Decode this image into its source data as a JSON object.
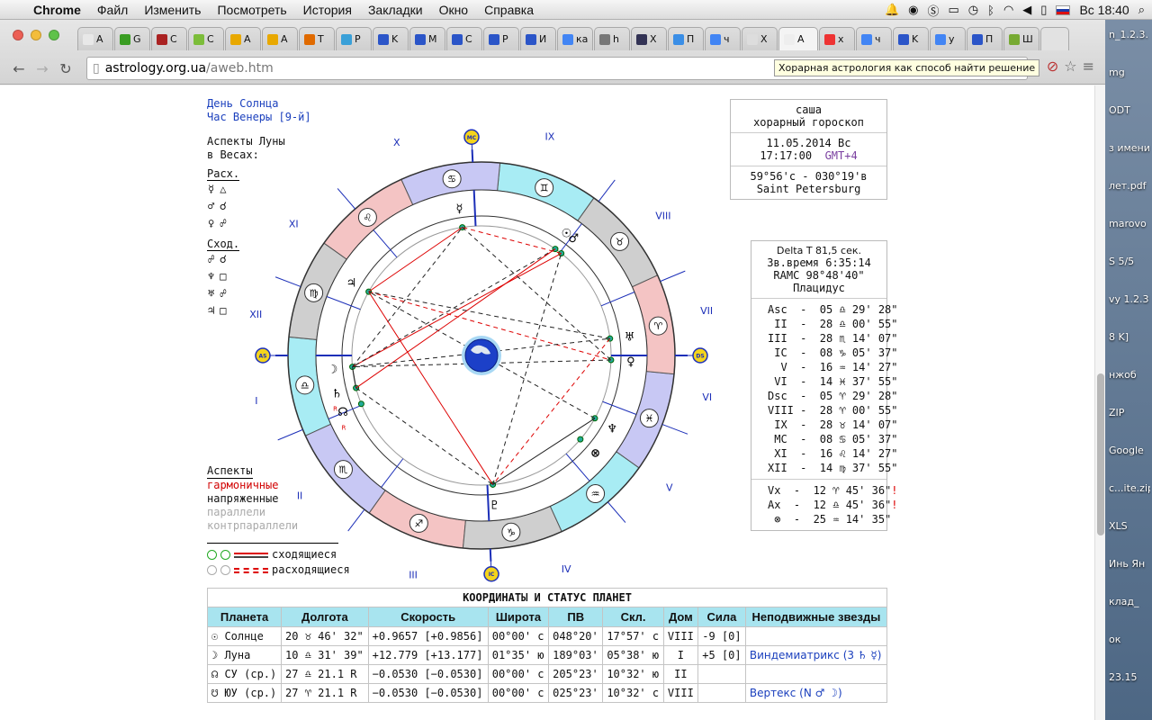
{
  "menubar": {
    "apple": "",
    "app": "Chrome",
    "items": [
      "Файл",
      "Изменить",
      "Посмотреть",
      "История",
      "Закладки",
      "Окно",
      "Справка"
    ],
    "clock": "Вс 18:40"
  },
  "browser": {
    "tabs": [
      {
        "label": "A",
        "color": "#e8e8e8"
      },
      {
        "label": "G",
        "color": "#3a9d23"
      },
      {
        "label": "C",
        "color": "#a22"
      },
      {
        "label": "C",
        "color": "#7cbd3a"
      },
      {
        "label": "A",
        "color": "#e8a800"
      },
      {
        "label": "A",
        "color": "#e8a800"
      },
      {
        "label": "T",
        "color": "#e06a00"
      },
      {
        "label": "P",
        "color": "#3aa0d8"
      },
      {
        "label": "K",
        "color": "#2b55c8"
      },
      {
        "label": "M",
        "color": "#2b55c8"
      },
      {
        "label": "C",
        "color": "#2b55c8"
      },
      {
        "label": "P",
        "color": "#2b55c8"
      },
      {
        "label": "И",
        "color": "#2b55c8"
      },
      {
        "label": "ка",
        "color": "#4285f4"
      },
      {
        "label": "h",
        "color": "#777"
      },
      {
        "label": "X",
        "color": "#335"
      },
      {
        "label": "П",
        "color": "#3a8ee6"
      },
      {
        "label": "ч",
        "color": "#4285f4"
      },
      {
        "label": "X",
        "color": "#ddd"
      },
      {
        "label": "A",
        "color": "#eee"
      },
      {
        "label": "x",
        "color": "#e33"
      },
      {
        "label": "ч",
        "color": "#4285f4"
      },
      {
        "label": "K",
        "color": "#2b55c8"
      },
      {
        "label": "y",
        "color": "#4285f4"
      },
      {
        "label": "П",
        "color": "#2b55c8"
      },
      {
        "label": "Ш",
        "color": "#7a3"
      }
    ],
    "url_domain": "astrology.org.ua",
    "url_path": "/aweb.htm",
    "tooltip": "Хорарная астрология как способ найти решение"
  },
  "desktop": {
    "icons": [
      "n_1.2.3.",
      "mg",
      "ODT",
      "з имени",
      "лет.pdf",
      "marovo",
      "S 5/5",
      "vy 1.2.3",
      "8 K]",
      "нжоб",
      "ZIP",
      "Google",
      "c...ite.zip",
      "XLS",
      "Инь Ян",
      "клад_",
      "ок",
      "23.15"
    ]
  },
  "chart_info": {
    "day": "День Солнца",
    "hour": "Час Венеры [9-й]",
    "moon_aspects_title": "Аспекты Луны",
    "moon_aspects_sign": "в Весах:",
    "separating_label": "Расх.",
    "separating": [
      {
        "planet": "☿",
        "aspect": "△"
      },
      {
        "planet": "♂",
        "aspect": "☌"
      },
      {
        "planet": "♀",
        "aspect": "☍"
      }
    ],
    "applying_label": "Сход.",
    "applying": [
      {
        "planet": "☍",
        "aspect": "☌"
      },
      {
        "planet": "♆",
        "aspect": "□"
      },
      {
        "planet": "♅",
        "aspect": "☍"
      },
      {
        "planet": "♃",
        "aspect": "□"
      }
    ],
    "aspects_legend_title": "Аспекты",
    "harmonic": "гармоничные",
    "tense": "напряженные",
    "parallels": "параллели",
    "contraparallels": "контрпараллели",
    "applying_legend": "сходящиеся",
    "separating_legend": "расходящиеся"
  },
  "wheel": {
    "houses": [
      "I",
      "II",
      "III",
      "IV",
      "V",
      "VI",
      "VII",
      "VIII",
      "IX",
      "X",
      "XI",
      "XII"
    ],
    "angles": {
      "asc": "AS",
      "dsc": "DS",
      "mc": "MC",
      "ic": "IC"
    },
    "signs": [
      "♎",
      "♏",
      "♐",
      "♑",
      "♒",
      "♓",
      "♈",
      "♉",
      "♊",
      "♋",
      "♌",
      "♍"
    ],
    "planets": [
      {
        "glyph": "♂",
        "name": "mars"
      },
      {
        "glyph": "☽",
        "name": "moon"
      },
      {
        "glyph": "☊",
        "name": "north-node"
      },
      {
        "glyph": "♄",
        "name": "saturn"
      },
      {
        "glyph": "♃",
        "name": "jupiter"
      },
      {
        "glyph": "☿",
        "name": "mercury"
      },
      {
        "glyph": "☉",
        "name": "sun"
      },
      {
        "glyph": "♅",
        "name": "uranus"
      },
      {
        "glyph": "♀",
        "name": "venus"
      },
      {
        "glyph": "♆",
        "name": "neptune"
      },
      {
        "glyph": "♇",
        "name": "pluto"
      },
      {
        "glyph": "⊗",
        "name": "part-of-fortune"
      }
    ],
    "retro_marker": "R"
  },
  "header_box": {
    "name": "саша",
    "type": "хорарный гороскоп",
    "date": "11.05.2014 Вс",
    "time": "17:17:00",
    "tz": "GMT+4",
    "coords": "59°56'с - 030°19'в",
    "city": "Saint Petersburg"
  },
  "cusps_box": {
    "delta_t": "Delta T  81,5 сек.",
    "sidereal": "Зв.время 6:35:14",
    "ramc": "RAMC 98°48'40\"",
    "system": "Плацидус",
    "cusps": [
      "Asc  -  05 ♎ 29' 28\"",
      " II  -  28 ♎ 00' 55\"",
      "III  -  28 ♏ 14' 07\"",
      " IC  -  08 ♑ 05' 37\"",
      "  V  -  16 ♒ 14' 27\"",
      " VI  -  14 ♓ 37' 55\"",
      "Dsc  -  05 ♈ 29' 28\"",
      "VIII -  28 ♈ 00' 55\"",
      " IX  -  28 ♉ 14' 07\"",
      " MC  -  08 ♋ 05' 37\"",
      " XI  -  16 ♌ 14' 27\"",
      "XII  -  14 ♍ 37' 55\""
    ],
    "extra": [
      "Vx  -  12 ♈ 45' 36\"",
      "Ax  -  12 ♎ 45' 36\"",
      " ⊗  -  25 ♒ 14' 35\""
    ],
    "warn": "!"
  },
  "planet_table": {
    "caption": "КООРДИНАТЫ И СТАТУС ПЛАНЕТ",
    "headers": [
      "Планета",
      "Долгота",
      "Скорость",
      "Широта",
      "ПВ",
      "Скл.",
      "Дом",
      "Сила",
      "Неподвижные звезды"
    ],
    "rows": [
      {
        "planet": "☉ Солнце",
        "lon": "20 ♉ 46' 32\"",
        "speed": "+0.9657  [+0.9856]",
        "lat": "00°00' с",
        "ra": "048°20'",
        "decl": "17°57' с",
        "house": "VIII",
        "power": "-9  [0]",
        "stars": ""
      },
      {
        "planet": "☽ Луна",
        "lon": "10 ♎ 31' 39\"",
        "speed": "+12.779  [+13.177]",
        "lat": "01°35' ю",
        "ra": "189°03'",
        "decl": "05°38' ю",
        "house": "I",
        "power": "+5  [0]",
        "stars": "Виндемиатрикс (3 ♄ ☿)"
      },
      {
        "planet": "☊ СУ  (ср.)",
        "lon": "27 ♎ 21.1  R",
        "speed": "−0.0530  [−0.0530]",
        "lat": "00°00' с",
        "ra": "205°23'",
        "decl": "10°32' ю",
        "house": "II",
        "power": "",
        "stars": ""
      },
      {
        "planet": "☋ ЮУ  (ср.)",
        "lon": "27 ♈ 21.1  R",
        "speed": "−0.0530  [−0.0530]",
        "lat": "00°00' с",
        "ra": "025°23'",
        "decl": "10°32' с",
        "house": "VIII",
        "power": "",
        "stars": "Вертекс (N ♂ ☽)"
      }
    ]
  }
}
